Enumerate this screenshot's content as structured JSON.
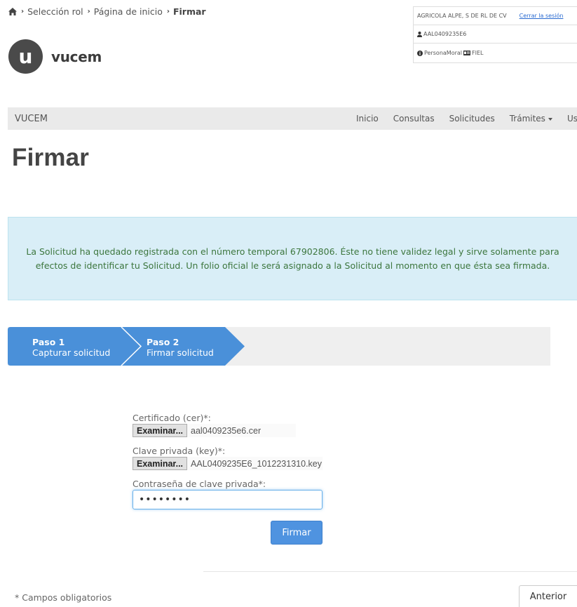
{
  "breadcrumb": {
    "items": [
      "Selección rol",
      "Página de inicio"
    ],
    "current": "Firmar"
  },
  "logo": {
    "letter": "u",
    "text": "vucem"
  },
  "user": {
    "company": "AGRICOLA ALPE, S DE RL DE CV",
    "logout": "Cerrar la sesión",
    "rfc": "AAL0409235E6",
    "role": "PersonaMoral",
    "auth": "FIEL"
  },
  "navbar": {
    "brand": "VUCEM",
    "items": [
      "Inicio",
      "Consultas",
      "Solicitudes",
      "Trámites",
      "Usuarios"
    ]
  },
  "page_title": "Firmar",
  "alert": {
    "line1": "La Solicitud ha quedado registrada con el número temporal 67902806. Éste no tiene validez legal y sirve solamente para",
    "line2": "efectos de identificar tu Solicitud. Un folio oficial le será asignado a la Solicitud al momento en que ésta sea firmada."
  },
  "wizard": {
    "steps": [
      {
        "title": "Paso 1",
        "subtitle": "Capturar solicitud"
      },
      {
        "title": "Paso 2",
        "subtitle": "Firmar solicitud"
      }
    ],
    "color": "#4a90d9"
  },
  "form": {
    "cert_label": "Certificado (cer)*:",
    "cert_button": "Examinar...",
    "cert_file": "aal0409235e6.cer",
    "key_label": "Clave privada (key)*:",
    "key_button": "Examinar...",
    "key_file": "AAL0409235E6_1012231310.key",
    "password_label": "Contraseña de clave privada*:",
    "password_value": "••••••••",
    "submit": "Firmar"
  },
  "footer": {
    "required_note": "* Campos obligatorios",
    "back_button": "Anterior"
  }
}
